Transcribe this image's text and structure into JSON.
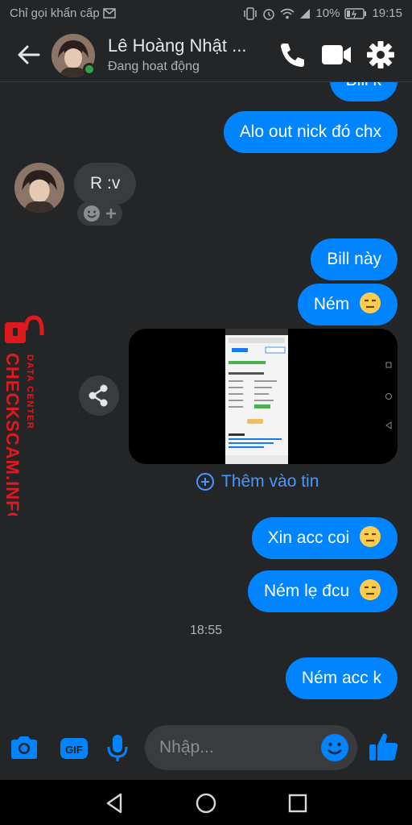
{
  "status_bar": {
    "carrier": "Chỉ gọi khẩn cấp",
    "battery": "10%",
    "time": "19:15"
  },
  "header": {
    "name": "Lê Hoàng Nhật ...",
    "status": "Đang hoạt động"
  },
  "messages": {
    "m0": "Bill k",
    "m1": "Alo out nick đó chx",
    "m2": "R :v",
    "m3": "Bill này",
    "m4": "Ném",
    "m5": "Xin acc coi",
    "m6": "Ném lẹ đcu",
    "m7": "Ném acc k"
  },
  "add_to_story": "Thêm vào tin",
  "timestamp": "18:55",
  "composer": {
    "placeholder": "Nhập..."
  },
  "watermark": {
    "brand": "CHECKSCAM.INFO",
    "sub": "DATA CENTER"
  },
  "colors": {
    "accent": "#0084ff",
    "background": "#242526",
    "received": "#3a3b3c",
    "online": "#31a24c",
    "watermark": "#e0191e"
  }
}
